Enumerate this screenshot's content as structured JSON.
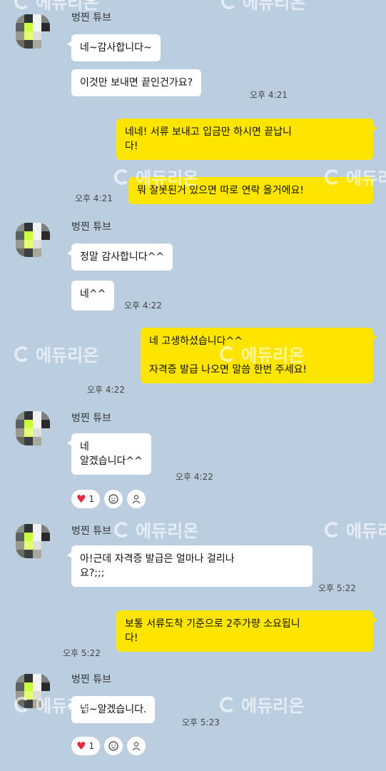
{
  "watermark": "에듀리온",
  "sender_name": "벙찐 튜브",
  "colors": {
    "background": "#bacee0",
    "incoming": "#ffffff",
    "outgoing": "#fee500",
    "heart": "#e02b3c"
  },
  "messages": {
    "m1": "네~감사합니다~",
    "m2": "이것만 보내면 끝인건가요?",
    "t1": "오후 4:21",
    "o1": "네네! 서류 보내고 입금만 하시면 끝납니\n다!",
    "o2": "뭐 잘못된거 있으면 따로 연락 올거에요!",
    "t2": "오후 4:21",
    "m3": "정말 감사합니다^^",
    "m4": "네^^",
    "t3": "오후 4:22",
    "o3": "네 고생하셨습니다^^\n\n자격증 발급 나오면 말씀 한번 주세요!",
    "t4": "오후 4:22",
    "m5": "네\n알겠습니다^^",
    "t5": "오후 4:22",
    "m6": "아!근데 자격증 발급은 얼마나 걸리나\n요?;;;",
    "t6": "오후 5:22",
    "o4": "보통 서류도착 기준으로 2주가량 소요됩니\n다!",
    "t7": "오후 5:22",
    "m7": "넵~알겠습니다.",
    "t8": "오후 5:23"
  },
  "reactions": {
    "heart_count": "1",
    "icons": [
      "heart-icon",
      "add-emoji-icon",
      "person-icon"
    ]
  }
}
